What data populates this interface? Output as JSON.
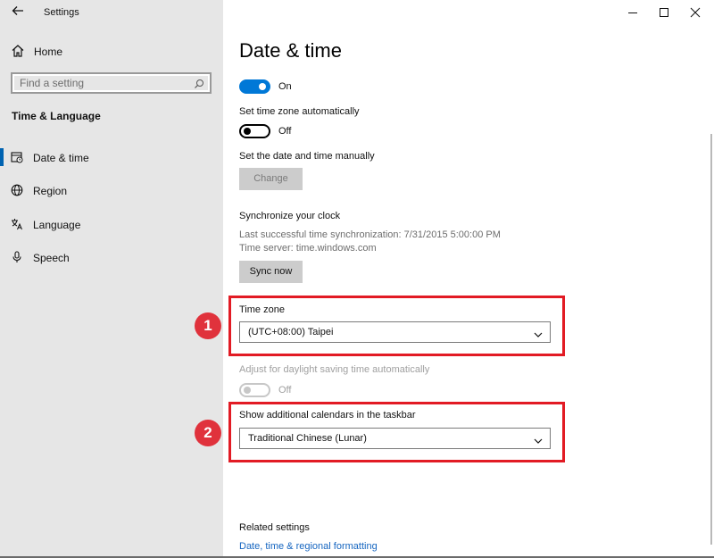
{
  "window": {
    "title": "Settings"
  },
  "sidebar": {
    "home_label": "Home",
    "search_placeholder": "Find a setting",
    "section_title": "Time & Language",
    "items": [
      {
        "label": "Date & time",
        "icon": "date-time-icon",
        "active": true
      },
      {
        "label": "Region",
        "icon": "globe-icon",
        "active": false
      },
      {
        "label": "Language",
        "icon": "language-icon",
        "active": false
      },
      {
        "label": "Speech",
        "icon": "microphone-icon",
        "active": false
      }
    ]
  },
  "main": {
    "title": "Date & time",
    "set_time_auto_toggle_state": "On",
    "set_timezone_auto_label": "Set time zone automatically",
    "set_timezone_auto_toggle_state": "Off",
    "set_manually_label": "Set the date and time manually",
    "change_button": "Change",
    "sync_heading": "Synchronize your clock",
    "sync_last": "Last successful time synchronization: 7/31/2015 5:00:00 PM",
    "sync_server": "Time server: time.windows.com",
    "sync_button": "Sync now",
    "timezone_label": "Time zone",
    "timezone_value": "(UTC+08:00) Taipei",
    "dst_label": "Adjust for daylight saving time automatically",
    "dst_toggle_state": "Off",
    "calendar_label": "Show additional calendars in the taskbar",
    "calendar_value": "Traditional Chinese (Lunar)",
    "related_heading": "Related settings",
    "related_link": "Date, time & regional formatting"
  },
  "annotations": {
    "badge1": "1",
    "badge2": "2"
  },
  "colors": {
    "accent": "#0078d7",
    "highlight": "#e21b24",
    "link": "#1565c0",
    "sidebar_bg": "#e6e6e6"
  }
}
